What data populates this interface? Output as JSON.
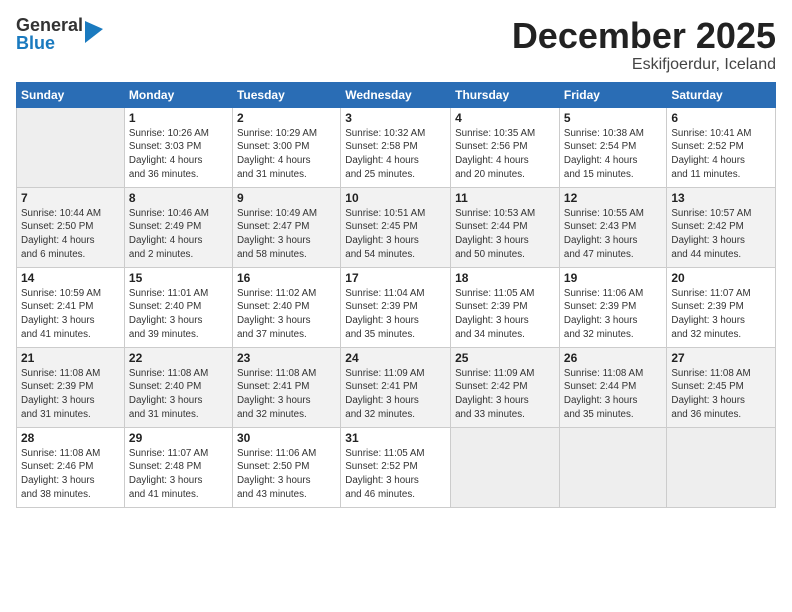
{
  "logo": {
    "general": "General",
    "blue": "Blue"
  },
  "title": {
    "month_year": "December 2025",
    "location": "Eskifjoerdur, Iceland"
  },
  "days_of_week": [
    "Sunday",
    "Monday",
    "Tuesday",
    "Wednesday",
    "Thursday",
    "Friday",
    "Saturday"
  ],
  "weeks": [
    [
      {
        "date": "",
        "info": ""
      },
      {
        "date": "1",
        "info": "Sunrise: 10:26 AM\nSunset: 3:03 PM\nDaylight: 4 hours\nand 36 minutes."
      },
      {
        "date": "2",
        "info": "Sunrise: 10:29 AM\nSunset: 3:00 PM\nDaylight: 4 hours\nand 31 minutes."
      },
      {
        "date": "3",
        "info": "Sunrise: 10:32 AM\nSunset: 2:58 PM\nDaylight: 4 hours\nand 25 minutes."
      },
      {
        "date": "4",
        "info": "Sunrise: 10:35 AM\nSunset: 2:56 PM\nDaylight: 4 hours\nand 20 minutes."
      },
      {
        "date": "5",
        "info": "Sunrise: 10:38 AM\nSunset: 2:54 PM\nDaylight: 4 hours\nand 15 minutes."
      },
      {
        "date": "6",
        "info": "Sunrise: 10:41 AM\nSunset: 2:52 PM\nDaylight: 4 hours\nand 11 minutes."
      }
    ],
    [
      {
        "date": "7",
        "info": "Sunrise: 10:44 AM\nSunset: 2:50 PM\nDaylight: 4 hours\nand 6 minutes."
      },
      {
        "date": "8",
        "info": "Sunrise: 10:46 AM\nSunset: 2:49 PM\nDaylight: 4 hours\nand 2 minutes."
      },
      {
        "date": "9",
        "info": "Sunrise: 10:49 AM\nSunset: 2:47 PM\nDaylight: 3 hours\nand 58 minutes."
      },
      {
        "date": "10",
        "info": "Sunrise: 10:51 AM\nSunset: 2:45 PM\nDaylight: 3 hours\nand 54 minutes."
      },
      {
        "date": "11",
        "info": "Sunrise: 10:53 AM\nSunset: 2:44 PM\nDaylight: 3 hours\nand 50 minutes."
      },
      {
        "date": "12",
        "info": "Sunrise: 10:55 AM\nSunset: 2:43 PM\nDaylight: 3 hours\nand 47 minutes."
      },
      {
        "date": "13",
        "info": "Sunrise: 10:57 AM\nSunset: 2:42 PM\nDaylight: 3 hours\nand 44 minutes."
      }
    ],
    [
      {
        "date": "14",
        "info": "Sunrise: 10:59 AM\nSunset: 2:41 PM\nDaylight: 3 hours\nand 41 minutes."
      },
      {
        "date": "15",
        "info": "Sunrise: 11:01 AM\nSunset: 2:40 PM\nDaylight: 3 hours\nand 39 minutes."
      },
      {
        "date": "16",
        "info": "Sunrise: 11:02 AM\nSunset: 2:40 PM\nDaylight: 3 hours\nand 37 minutes."
      },
      {
        "date": "17",
        "info": "Sunrise: 11:04 AM\nSunset: 2:39 PM\nDaylight: 3 hours\nand 35 minutes."
      },
      {
        "date": "18",
        "info": "Sunrise: 11:05 AM\nSunset: 2:39 PM\nDaylight: 3 hours\nand 34 minutes."
      },
      {
        "date": "19",
        "info": "Sunrise: 11:06 AM\nSunset: 2:39 PM\nDaylight: 3 hours\nand 32 minutes."
      },
      {
        "date": "20",
        "info": "Sunrise: 11:07 AM\nSunset: 2:39 PM\nDaylight: 3 hours\nand 32 minutes."
      }
    ],
    [
      {
        "date": "21",
        "info": "Sunrise: 11:08 AM\nSunset: 2:39 PM\nDaylight: 3 hours\nand 31 minutes."
      },
      {
        "date": "22",
        "info": "Sunrise: 11:08 AM\nSunset: 2:40 PM\nDaylight: 3 hours\nand 31 minutes."
      },
      {
        "date": "23",
        "info": "Sunrise: 11:08 AM\nSunset: 2:41 PM\nDaylight: 3 hours\nand 32 minutes."
      },
      {
        "date": "24",
        "info": "Sunrise: 11:09 AM\nSunset: 2:41 PM\nDaylight: 3 hours\nand 32 minutes."
      },
      {
        "date": "25",
        "info": "Sunrise: 11:09 AM\nSunset: 2:42 PM\nDaylight: 3 hours\nand 33 minutes."
      },
      {
        "date": "26",
        "info": "Sunrise: 11:08 AM\nSunset: 2:44 PM\nDaylight: 3 hours\nand 35 minutes."
      },
      {
        "date": "27",
        "info": "Sunrise: 11:08 AM\nSunset: 2:45 PM\nDaylight: 3 hours\nand 36 minutes."
      }
    ],
    [
      {
        "date": "28",
        "info": "Sunrise: 11:08 AM\nSunset: 2:46 PM\nDaylight: 3 hours\nand 38 minutes."
      },
      {
        "date": "29",
        "info": "Sunrise: 11:07 AM\nSunset: 2:48 PM\nDaylight: 3 hours\nand 41 minutes."
      },
      {
        "date": "30",
        "info": "Sunrise: 11:06 AM\nSunset: 2:50 PM\nDaylight: 3 hours\nand 43 minutes."
      },
      {
        "date": "31",
        "info": "Sunrise: 11:05 AM\nSunset: 2:52 PM\nDaylight: 3 hours\nand 46 minutes."
      },
      {
        "date": "",
        "info": ""
      },
      {
        "date": "",
        "info": ""
      },
      {
        "date": "",
        "info": ""
      }
    ]
  ]
}
